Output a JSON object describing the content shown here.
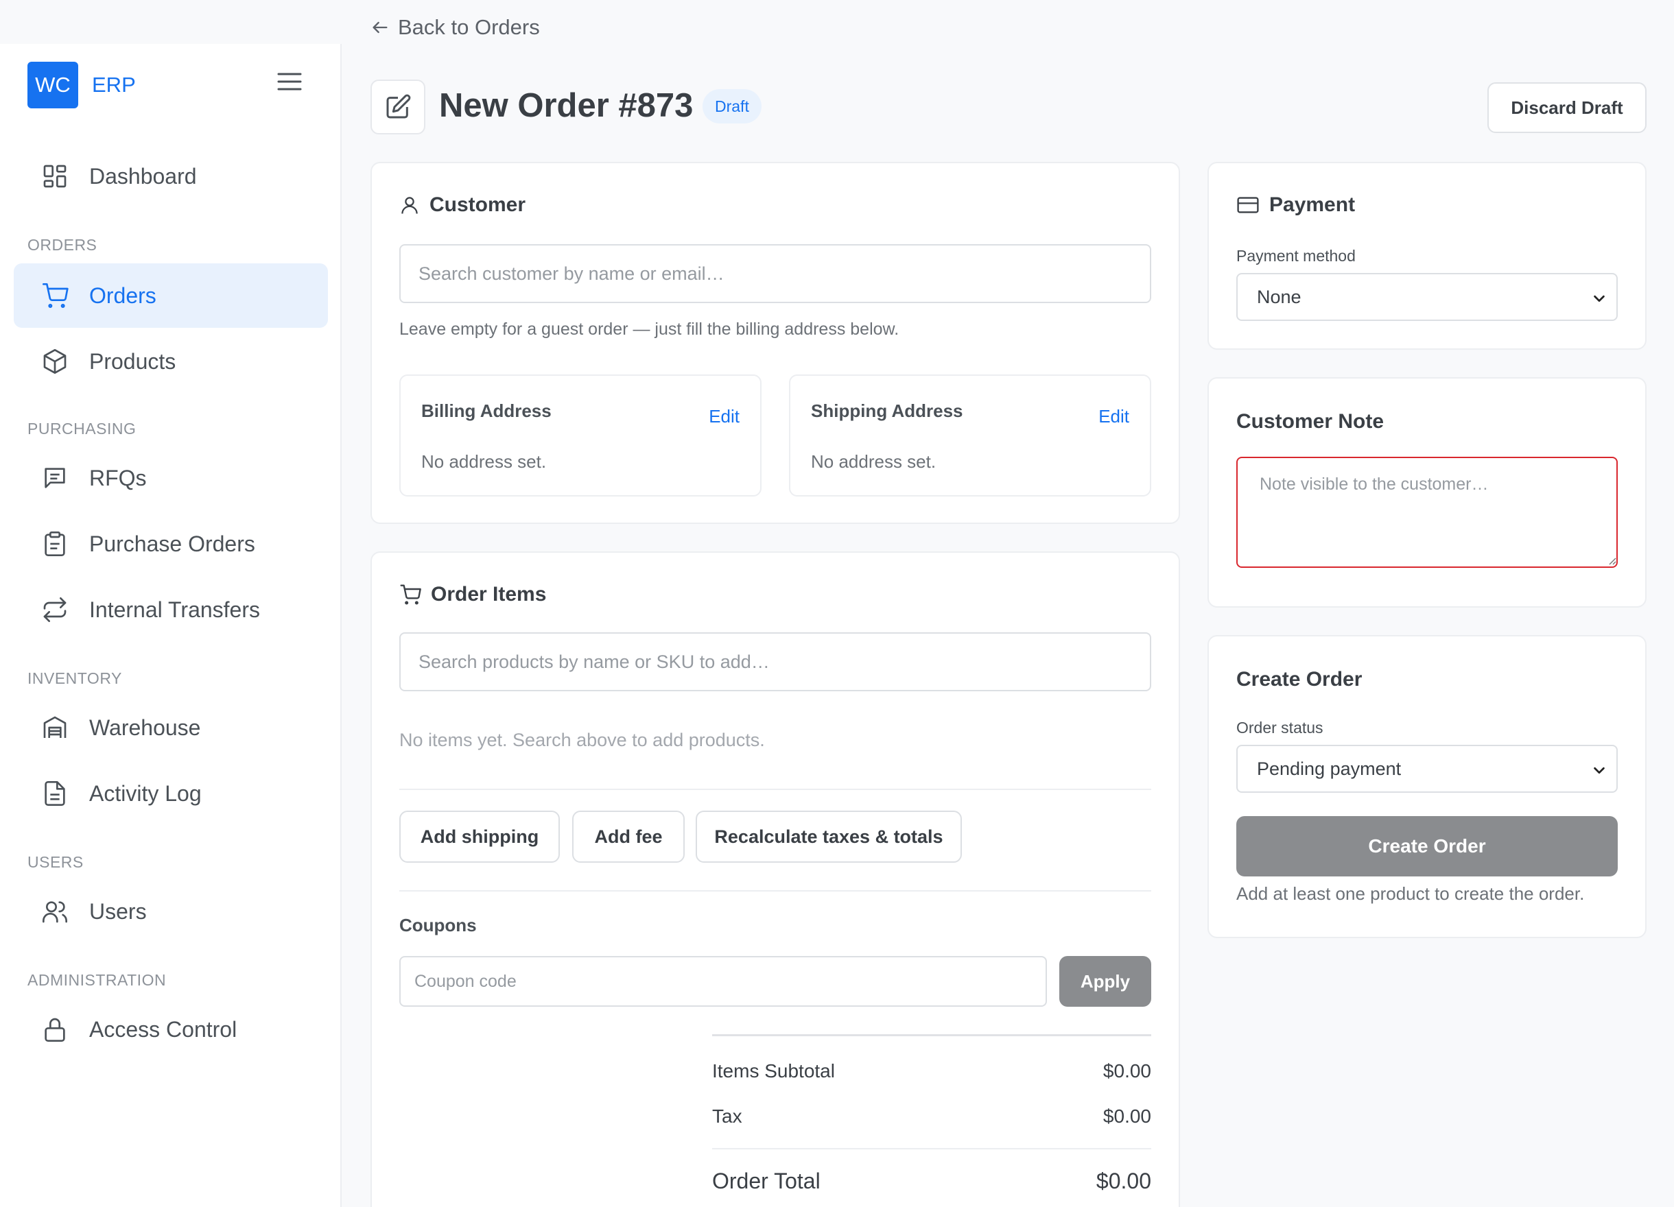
{
  "header": {
    "back_label": "Back to Orders",
    "title": "New Order #873",
    "badge": "Draft",
    "discard_label": "Discard Draft"
  },
  "sidebar": {
    "logo": "WC",
    "brand": "ERP",
    "sections": {
      "orders": "ORDERS",
      "purchasing": "PURCHASING",
      "inventory": "INVENTORY",
      "users": "USERS",
      "administration": "ADMINISTRATION"
    },
    "items": {
      "dashboard": "Dashboard",
      "orders": "Orders",
      "products": "Products",
      "rfqs": "RFQs",
      "purchase_orders": "Purchase Orders",
      "internal_transfers": "Internal Transfers",
      "warehouse": "Warehouse",
      "activity_log": "Activity Log",
      "users": "Users",
      "access_control": "Access Control"
    }
  },
  "customer": {
    "title": "Customer",
    "search_placeholder": "Search customer by name or email…",
    "hint": "Leave empty for a guest order — just fill the billing address below.",
    "billing": {
      "title": "Billing Address",
      "edit": "Edit",
      "empty": "No address set."
    },
    "shipping": {
      "title": "Shipping Address",
      "edit": "Edit",
      "empty": "No address set."
    }
  },
  "order_items": {
    "title": "Order Items",
    "search_placeholder": "Search products by name or SKU to add…",
    "empty": "No items yet. Search above to add products.",
    "buttons": {
      "add_shipping": "Add shipping",
      "add_fee": "Add fee",
      "recalculate": "Recalculate taxes & totals"
    },
    "coupons_label": "Coupons",
    "coupon_placeholder": "Coupon code",
    "apply_label": "Apply",
    "totals": {
      "subtotal_label": "Items Subtotal",
      "subtotal_value": "$0.00",
      "tax_label": "Tax",
      "tax_value": "$0.00",
      "total_label": "Order Total",
      "total_value": "$0.00"
    }
  },
  "payment": {
    "title": "Payment",
    "method_label": "Payment method",
    "method_value": "None"
  },
  "customer_note": {
    "title": "Customer Note",
    "placeholder": "Note visible to the customer…"
  },
  "create_order": {
    "title": "Create Order",
    "status_label": "Order status",
    "status_value": "Pending payment",
    "button_label": "Create Order",
    "hint": "Add at least one product to create the order."
  },
  "colors": {
    "accent": "#1672f0",
    "accent_bg": "#e8f1fd",
    "disabled_button": "#8a8c8f",
    "error_border": "#d9272e"
  }
}
